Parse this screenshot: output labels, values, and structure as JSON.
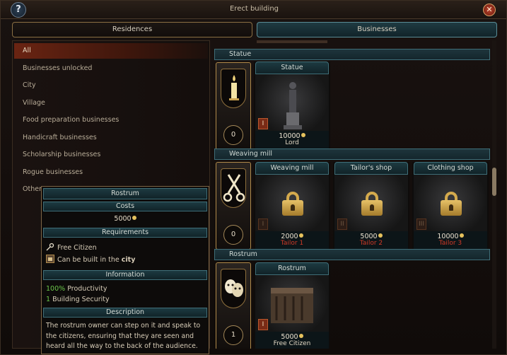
{
  "window": {
    "title": "Erect building",
    "help_label": "?",
    "close_label": "✕"
  },
  "tabs": [
    {
      "label": "Residences",
      "active": false
    },
    {
      "label": "Businesses",
      "active": true
    }
  ],
  "categories": [
    {
      "label": "All",
      "active": true
    },
    {
      "label": "Businesses unlocked"
    },
    {
      "label": "City"
    },
    {
      "label": "Village"
    },
    {
      "label": "Food preparation businesses"
    },
    {
      "label": "Handicraft businesses"
    },
    {
      "label": "Scholarship businesses"
    },
    {
      "label": "Rogue businesses"
    },
    {
      "label": "Others"
    }
  ],
  "groups": [
    {
      "header": "Statue",
      "icon": "candle-icon",
      "count": "0",
      "cards": [
        {
          "name": "Statue",
          "price": "10000",
          "requirement": "Lord",
          "requirement_color": "#e0d6c2",
          "locked": false,
          "level": "I"
        }
      ]
    },
    {
      "header": "Weaving mill",
      "icon": "scissors-icon",
      "count": "0",
      "cards": [
        {
          "name": "Weaving mill",
          "price": "2000",
          "requirement": "Tailor 1",
          "requirement_color": "#d03a28",
          "locked": true,
          "level": "I"
        },
        {
          "name": "Tailor's shop",
          "price": "5000",
          "requirement": "Tailor 2",
          "requirement_color": "#d03a28",
          "locked": true,
          "level": "II"
        },
        {
          "name": "Clothing shop",
          "price": "10000",
          "requirement": "Tailor 3",
          "requirement_color": "#d03a28",
          "locked": true,
          "level": "III"
        }
      ]
    },
    {
      "header": "Rostrum",
      "icon": "theater-masks-icon",
      "count": "1",
      "cards": [
        {
          "name": "Rostrum",
          "price": "5000",
          "requirement": "Free Citizen",
          "requirement_color": "#e0d6c2",
          "locked": false,
          "level": "I"
        }
      ]
    }
  ],
  "tooltip": {
    "title": "Rostrum",
    "costs_header": "Costs",
    "cost": "5000",
    "requirements_header": "Requirements",
    "req_citizen": "Free Citizen",
    "req_city_prefix": "Can be built in the ",
    "req_city_bold": "city",
    "information_header": "Information",
    "info_productivity_value": "100%",
    "info_productivity_label": " Productivity",
    "info_security_value": "1",
    "info_security_label": " Building Security",
    "description_header": "Description",
    "description": "The rostrum owner can step on it and speak to the citizens, ensuring that they are seen and heard all the way to the back of the audience."
  }
}
